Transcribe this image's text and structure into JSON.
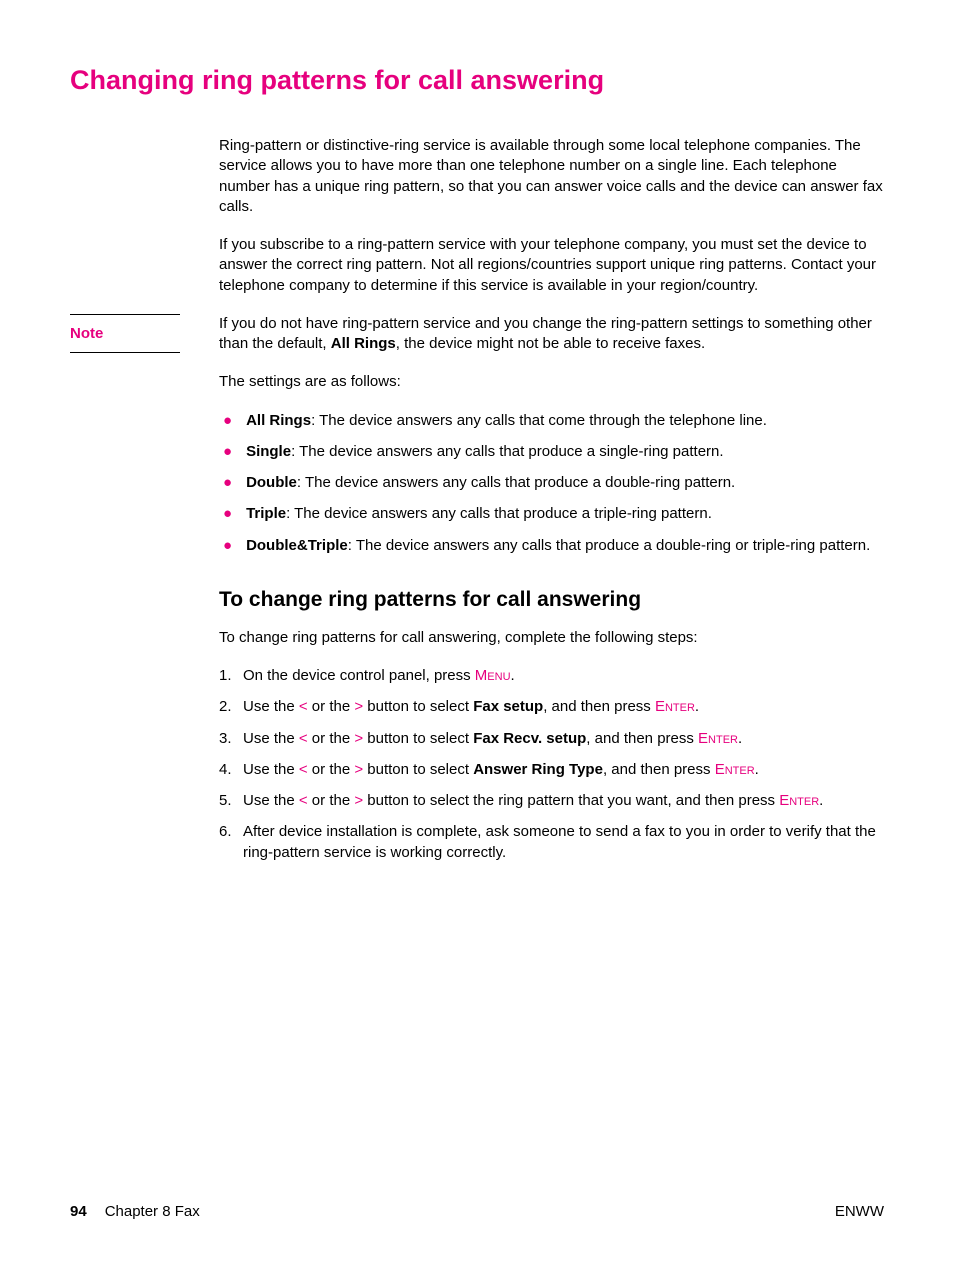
{
  "heading": "Changing ring patterns for call answering",
  "intro1": "Ring-pattern or distinctive-ring service is available through some local telephone companies. The service allows you to have more than one telephone number on a single line. Each telephone number has a unique ring pattern, so that you can answer voice calls and the device can answer fax calls.",
  "intro2": "If you subscribe to a ring-pattern service with your telephone company, you must set the device to answer the correct ring pattern. Not all regions/countries support unique ring patterns. Contact your telephone company to determine if this service is available in your region/country.",
  "note_label": "Note",
  "note_text_pre": "If you do not have ring-pattern service and you change the ring-pattern settings to something other than the default, ",
  "note_bold": "All Rings",
  "note_text_post": ", the device might not be able to receive faxes.",
  "settings_intro": "The settings are as follows:",
  "bullets": [
    {
      "label": "All Rings",
      "desc": ": The device answers any calls that come through the telephone line."
    },
    {
      "label": "Single",
      "desc": ": The device answers any calls that produce a single-ring pattern."
    },
    {
      "label": "Double",
      "desc": ": The device answers any calls that produce a double-ring pattern."
    },
    {
      "label": "Triple",
      "desc": ": The device answers any calls that produce a triple-ring pattern."
    },
    {
      "label": "Double&Triple",
      "desc": ": The device answers any calls that produce a double-ring or triple-ring pattern."
    }
  ],
  "sub_heading": "To change ring patterns for call answering",
  "steps_intro": "To change ring patterns for call answering, complete the following steps:",
  "step1_pre": "On the device control panel, press ",
  "step2_pre": "Use the ",
  "lt": "<",
  "or": " or the ",
  "gt": ">",
  "step2_mid": " button to select ",
  "step2_bold": "Fax setup",
  "step2_post": ", and then press ",
  "step3_bold": "Fax Recv. setup",
  "step4_bold": "Answer Ring Type",
  "step5_mid": " button to select the ring pattern that you want, and then press ",
  "step6": "After device installation is complete, ask someone to send a fax to you in order to verify that the ring-pattern service is working correctly.",
  "keys": {
    "menu": "Menu",
    "enter": "Enter"
  },
  "period": ".",
  "footer": {
    "page_num": "94",
    "chapter": "Chapter 8  Fax",
    "lang": "ENWW"
  }
}
